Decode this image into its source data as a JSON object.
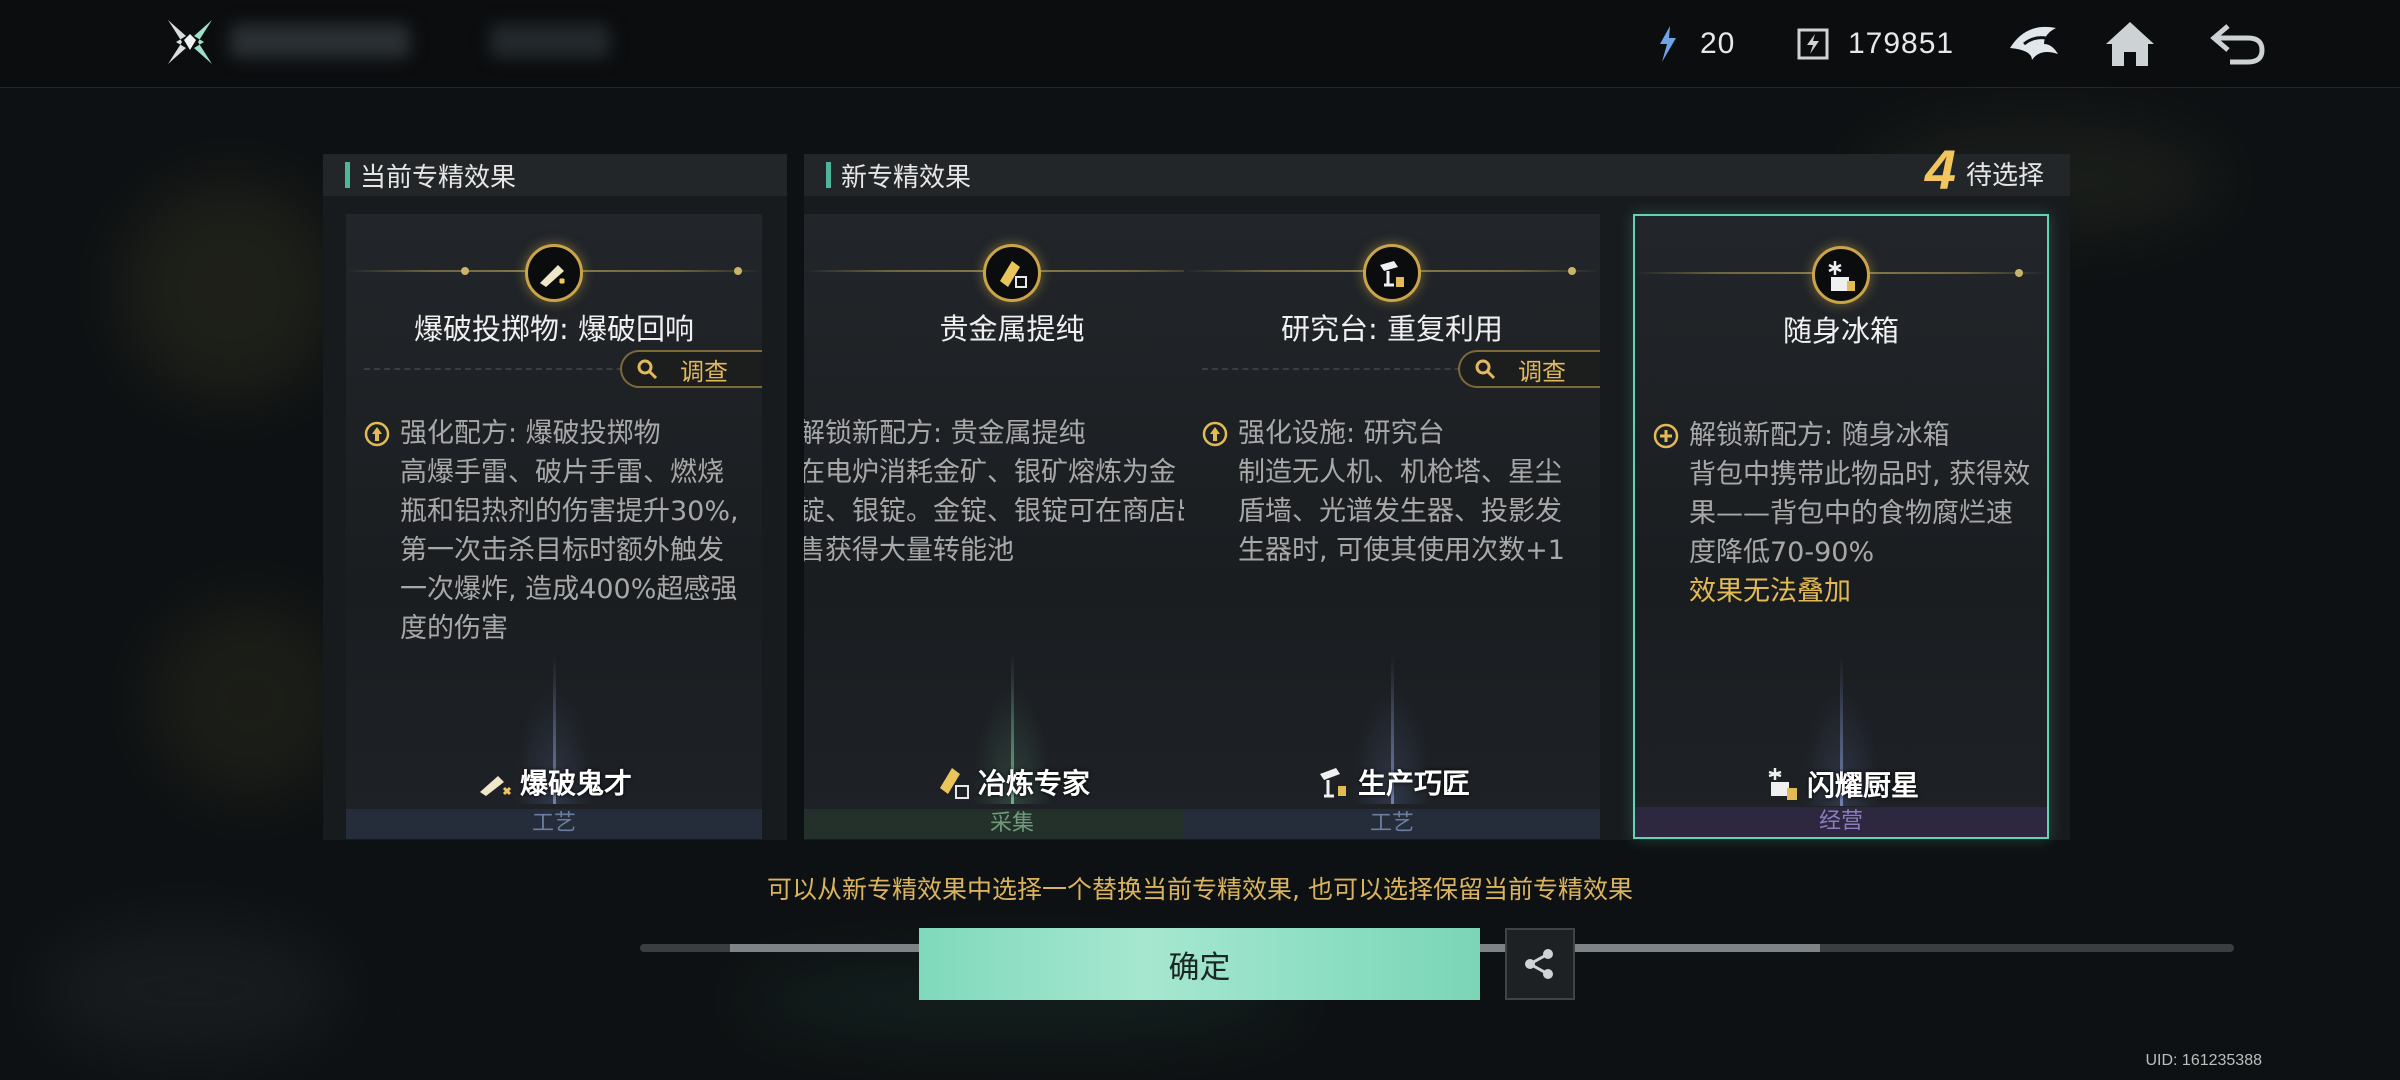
{
  "topbar": {
    "resource1": {
      "icon": "energy-crystal-icon",
      "value": "20"
    },
    "resource2": {
      "icon": "coin-chip-icon",
      "value": "179851"
    },
    "icons": [
      "faction-emblem-icon",
      "home-icon",
      "back-icon"
    ]
  },
  "current": {
    "header": "当前专精效果",
    "card": {
      "title": "爆破投掷物: 爆破回响",
      "investigate": "调查",
      "effect_head": "强化配方: 爆破投掷物",
      "effect_body": "高爆手雷、破片手雷、燃烧瓶和铝热剂的伤害提升30%, 第一次击杀目标时额外触发一次爆炸, 造成400%超感强度的伤害",
      "skill": "爆破鬼才",
      "category": "工艺"
    }
  },
  "new": {
    "header": "新专精效果",
    "pending_count": "4",
    "pending_label": "待选择",
    "cards": [
      {
        "title": "贵金属提纯",
        "effect_head": "解锁新配方: 贵金属提纯",
        "effect_body": "在电炉消耗金矿、银矿熔炼为金锭、银锭。金锭、银锭可在商店出售获得大量转能池",
        "skill": "冶炼专家",
        "category": "采集"
      },
      {
        "title": "研究台: 重复利用",
        "investigate": "调查",
        "effect_head": "强化设施: 研究台",
        "effect_body": "制造无人机、机枪塔、星尘盾墙、光谱发生器、投影发生器时, 可使其使用次数+1",
        "skill": "生产巧匠",
        "category": "工艺"
      },
      {
        "title": "随身冰箱",
        "effect_head": "解锁新配方: 随身冰箱",
        "effect_body": "背包中携带此物品时, 获得效果——背包中的食物腐烂速度降低70-90%",
        "effect_warn": "效果无法叠加",
        "skill": "闪耀厨星",
        "category": "经营"
      }
    ]
  },
  "hint": "可以从新专精效果中选择一个替换当前专精效果, 也可以选择保留当前专精效果",
  "confirm_label": "确定",
  "uid": "UID: 161235388",
  "colors": {
    "accent": "#62d3b4",
    "gold": "#e3bb55",
    "confirm": "#8fdfc4"
  }
}
